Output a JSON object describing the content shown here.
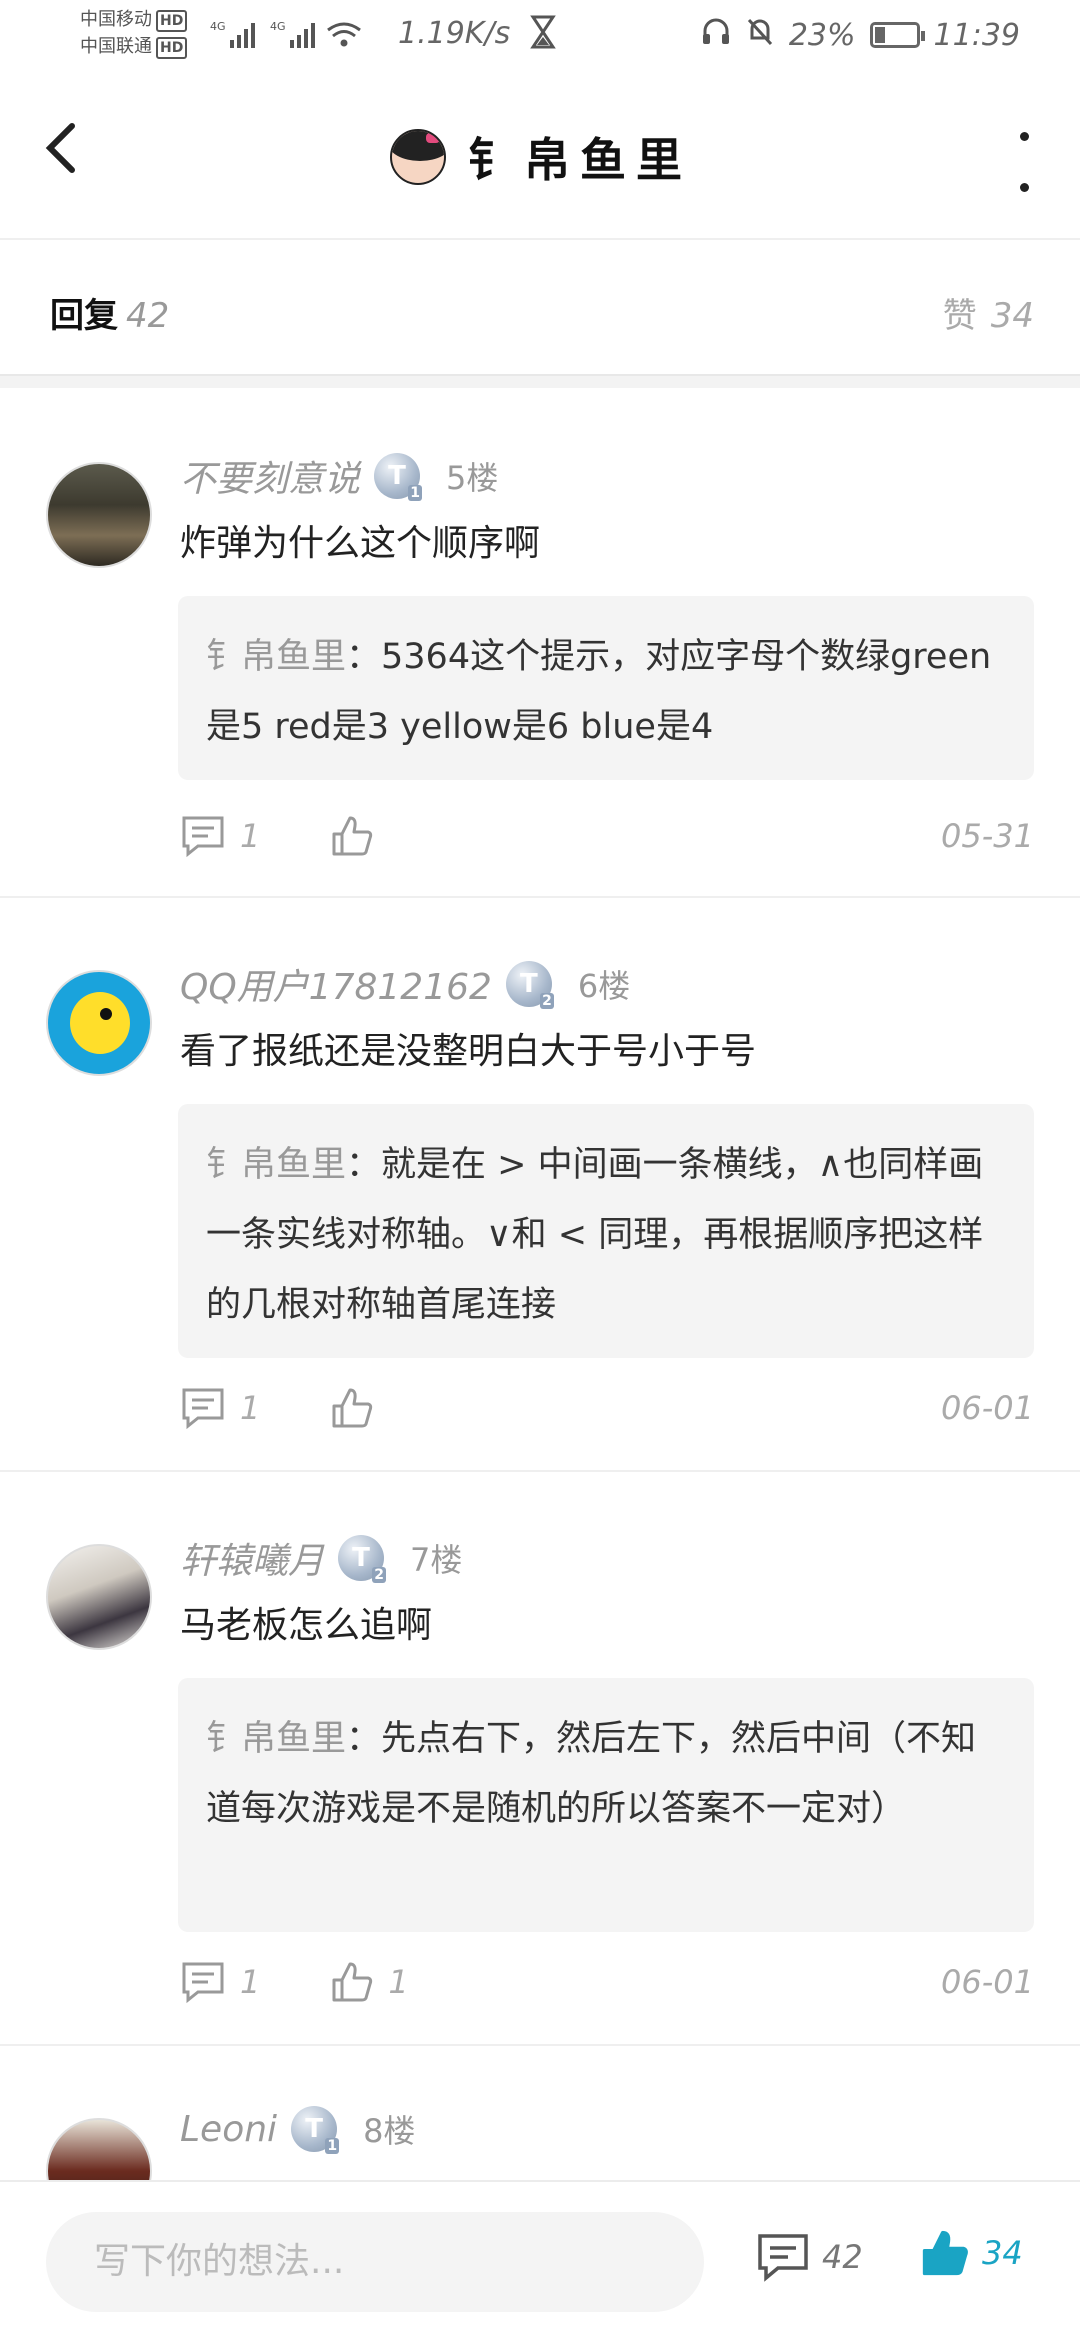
{
  "status_bar": {
    "carrier1": "中国移动",
    "carrier2": "中国联通",
    "hd": "HD",
    "network1": "4G",
    "network2": "4G",
    "speed": "1.19K/s",
    "battery": "23%",
    "time": "11:39"
  },
  "header": {
    "title": "钅帛鱼里"
  },
  "reply_bar": {
    "replies_label": "回复",
    "replies_count": "42",
    "likes_label": "赞",
    "likes_count": "34"
  },
  "comments": [
    {
      "name": "不要刻意说",
      "badge": "T",
      "badge_level": "1",
      "floor": "5楼",
      "text": "炸弹为什么这个顺序啊",
      "reply_name": "钅帛鱼里",
      "reply_text": "：5364这个提示，对应字母个数绿green是5 red是3  yellow是6 blue是4",
      "reply_count": "1",
      "like_count": "",
      "date": "05-31"
    },
    {
      "name": "QQ用户17812162",
      "badge": "T",
      "badge_level": "2",
      "floor": "6楼",
      "text": "看了报纸还是没整明白大于号小于号",
      "reply_name": "钅帛鱼里",
      "reply_text": "：就是在 > 中间画一条横线，∧也同样画一条实线对称轴。∨和 < 同理，再根据顺序把这样的几根对称轴首尾连接",
      "reply_count": "1",
      "like_count": "",
      "date": "06-01"
    },
    {
      "name": "轩辕曦月",
      "badge": "T",
      "badge_level": "2",
      "floor": "7楼",
      "text": "马老板怎么追啊",
      "reply_name": "钅帛鱼里",
      "reply_text": "：先点右下，然后左下，然后中间（不知道每次游戏是不是随机的所以答案不一定对）",
      "reply_count": "1",
      "like_count": "1",
      "date": "06-01"
    },
    {
      "name": "Leoni",
      "badge": "T",
      "badge_level": "1",
      "floor": "8楼"
    }
  ],
  "bottom_bar": {
    "input_placeholder": "写下你的想法...",
    "comment_count": "42",
    "like_count": "34"
  },
  "colors": {
    "accent": "#1aa4c4",
    "muted_text": "#999999",
    "quote_bg": "#f4f4f4"
  }
}
